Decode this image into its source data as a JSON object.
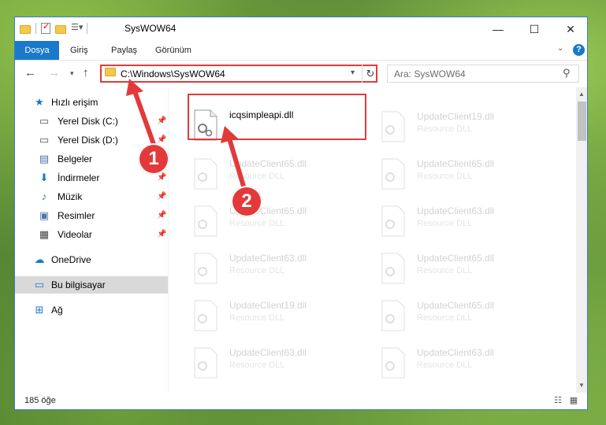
{
  "window": {
    "title": "SysWOW64",
    "controls": {
      "minimize": "—",
      "maximize": "☐",
      "close": "✕"
    }
  },
  "ribbon": {
    "tabs": [
      "Dosya",
      "Giriş",
      "Paylaş",
      "Görünüm"
    ],
    "help": "?"
  },
  "navigation": {
    "address": "C:\\Windows\\SysWOW64",
    "search_placeholder": "Ara: SysWOW64"
  },
  "sidebar": {
    "items": [
      {
        "label": "Hızlı erişim",
        "icon": "star-icon",
        "pinned": false
      },
      {
        "label": "Yerel Disk (C:)",
        "icon": "drive-icon",
        "pinned": true
      },
      {
        "label": "Yerel Disk (D:)",
        "icon": "drive-icon",
        "pinned": true
      },
      {
        "label": "Belgeler",
        "icon": "documents-icon",
        "pinned": true
      },
      {
        "label": "İndirmeler",
        "icon": "download-icon",
        "pinned": true
      },
      {
        "label": "Müzik",
        "icon": "music-icon",
        "pinned": true
      },
      {
        "label": "Resimler",
        "icon": "pictures-icon",
        "pinned": true
      },
      {
        "label": "Videolar",
        "icon": "videos-icon",
        "pinned": true
      },
      {
        "label": "OneDrive",
        "icon": "cloud-icon",
        "pinned": false
      },
      {
        "label": "Bu bilgisayar",
        "icon": "computer-icon",
        "pinned": false,
        "selected": true
      },
      {
        "label": "Ağ",
        "icon": "network-icon",
        "pinned": false
      }
    ]
  },
  "files": {
    "highlighted": {
      "name": "icqsimpleapi.dll",
      "type": ""
    },
    "left_column": [
      {
        "name": "UpdateClient65.dll",
        "type": "Resource DLL"
      },
      {
        "name": "UpdateClient65.dll",
        "type": "Resource DLL"
      },
      {
        "name": "UpdateClient63.dll",
        "type": "Resource DLL"
      },
      {
        "name": "UpdateClient19.dll",
        "type": "Resource DLL"
      },
      {
        "name": "UpdateClient63.dll",
        "type": "Resource DLL"
      }
    ],
    "right_column": [
      {
        "name": "UpdateClient19.dll",
        "type": "Resource DLL"
      },
      {
        "name": "UpdateClient65.dll",
        "type": "Resource DLL"
      },
      {
        "name": "UpdateClient63.dll",
        "type": "Resource DLL"
      },
      {
        "name": "UpdateClient65.dll",
        "type": "Resource DLL"
      },
      {
        "name": "UpdateClient65.dll",
        "type": "Resource DLL"
      },
      {
        "name": "UpdateClient63.dll",
        "type": "Resource DLL"
      }
    ]
  },
  "status": {
    "item_count": "185 öğe"
  },
  "callouts": [
    "1",
    "2"
  ],
  "colors": {
    "accent": "#1979ca",
    "highlight": "#e23a3a",
    "folder": "#f3c94d"
  }
}
